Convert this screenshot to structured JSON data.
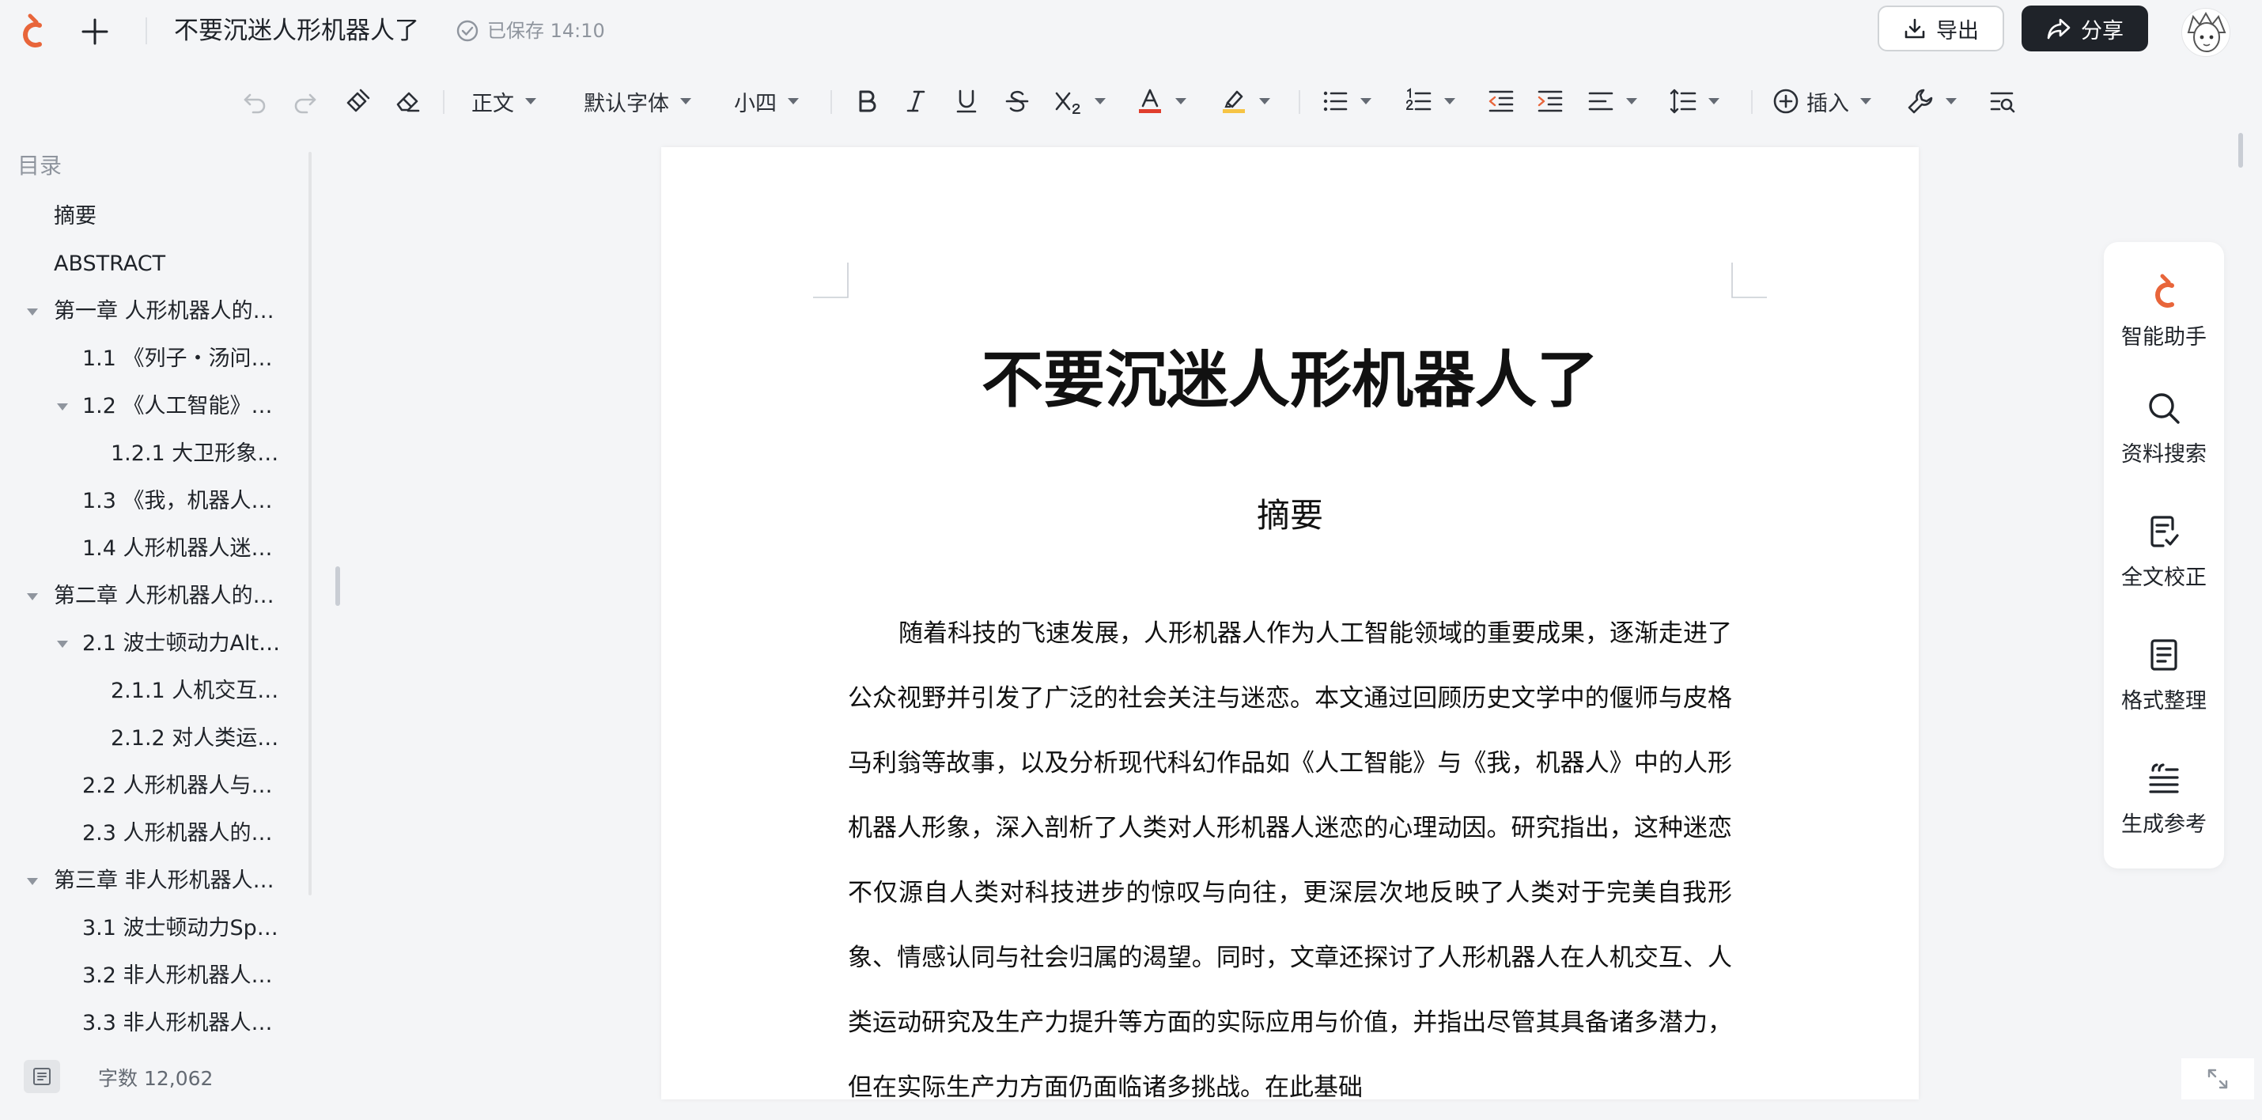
{
  "header": {
    "doc_title": "不要沉迷人形机器人了",
    "saved_status": "已保存 14:10",
    "export_label": "导出",
    "share_label": "分享"
  },
  "toolbar": {
    "style_value": "正文",
    "font_value": "默认字体",
    "size_value": "小四",
    "insert_label": "插入"
  },
  "toc": {
    "title": "目录",
    "items": [
      "摘要",
      "ABSTRACT",
      "第一章 人形机器人的…",
      "1.1 《列子・汤问…",
      "1.2 《人工智能》…",
      "1.2.1 大卫形象…",
      "1.3 《我，机器人…",
      "1.4 人形机器人迷…",
      "第二章 人形机器人的…",
      "2.1 波士顿动力Alt…",
      "2.1.1 人机交互…",
      "2.1.2 对人类运…",
      "2.2 人形机器人与…",
      "2.3 人形机器人的…",
      "第三章 非人形机器人…",
      "3.1 波士顿动力Sp…",
      "3.2 非人形机器人…",
      "3.3 非人形机器人…"
    ]
  },
  "status": {
    "word_count": "字数 12,062"
  },
  "document": {
    "title": "不要沉迷人形机器人了",
    "abstract_heading": "摘要",
    "abstract_body": "随着科技的飞速发展，人形机器人作为人工智能领域的重要成果，逐渐走进了公众视野并引发了广泛的社会关注与迷恋。本文通过回顾历史文学中的偃师与皮格马利翁等故事，以及分析现代科幻作品如《人工智能》与《我，机器人》中的人形机器人形象，深入剖析了人类对人形机器人迷恋的心理动因。研究指出，这种迷恋不仅源自人类对科技进步的惊叹与向往，更深层次地反映了人类对于完美自我形象、情感认同与社会归属的渴望。同时，文章还探讨了人形机器人在人机交互、人类运动研究及生产力提升等方面的实际应用与价值，并指出尽管其具备诸多潜力，但在实际生产力方面仍面临诸多挑战。在此基础"
  },
  "right_panel": {
    "items": [
      "智能助手",
      "资料搜索",
      "全文校正",
      "格式整理",
      "生成参考"
    ]
  },
  "colors": {
    "brand_orange": "#e8653a",
    "font_color_red": "#e03e2d",
    "highlight_yellow": "#f6c445",
    "dark_button": "#1f2329"
  }
}
